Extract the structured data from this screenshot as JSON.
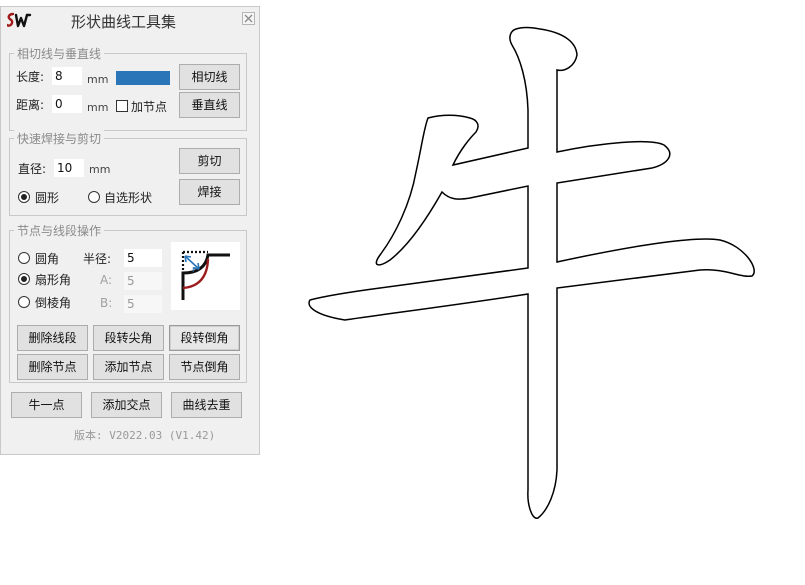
{
  "window": {
    "title": "形状曲线工具集",
    "logo_text": "SW",
    "close_icon": "close-icon"
  },
  "tangent_group": {
    "title": "相切线与垂直线",
    "length_label": "长度:",
    "length_value": "8",
    "length_unit": "mm",
    "swatch_color": "#2a74b8",
    "tangent_button": "相切线",
    "distance_label": "距离:",
    "distance_value": "0",
    "distance_unit": "mm",
    "add_node_checkbox": "加节点",
    "add_node_checked": false,
    "vertical_button": "垂直线"
  },
  "weld_group": {
    "title": "快速焊接与剪切",
    "diameter_label": "直径:",
    "diameter_value": "10",
    "diameter_unit": "mm",
    "cut_button": "剪切",
    "shape_options": [
      "圆形",
      "自选形状"
    ],
    "shape_selected": 0,
    "weld_button": "焊接"
  },
  "node_group": {
    "title": "节点与线段操作",
    "corner_options": [
      "圆角",
      "扇形角",
      "倒棱角"
    ],
    "corner_selected": 1,
    "radius_label": "半径:",
    "radius_value": "5",
    "a_label": "A:",
    "a_value": "5",
    "b_label": "B:",
    "b_value": "5",
    "preview_icon": "scallop-corner-preview-icon",
    "preview_color": "#9b1c1c",
    "buttons_row1": [
      "删除线段",
      "段转尖角",
      "段转倒角"
    ],
    "buttons_row2": [
      "删除节点",
      "添加节点",
      "节点倒角"
    ]
  },
  "bottom_buttons": [
    "牛一点",
    "添加交点",
    "曲线去重"
  ],
  "version": "版本: V2022.03 (V1.42)",
  "canvas": {
    "glyph": "牛",
    "stroke_color": "#000000"
  }
}
